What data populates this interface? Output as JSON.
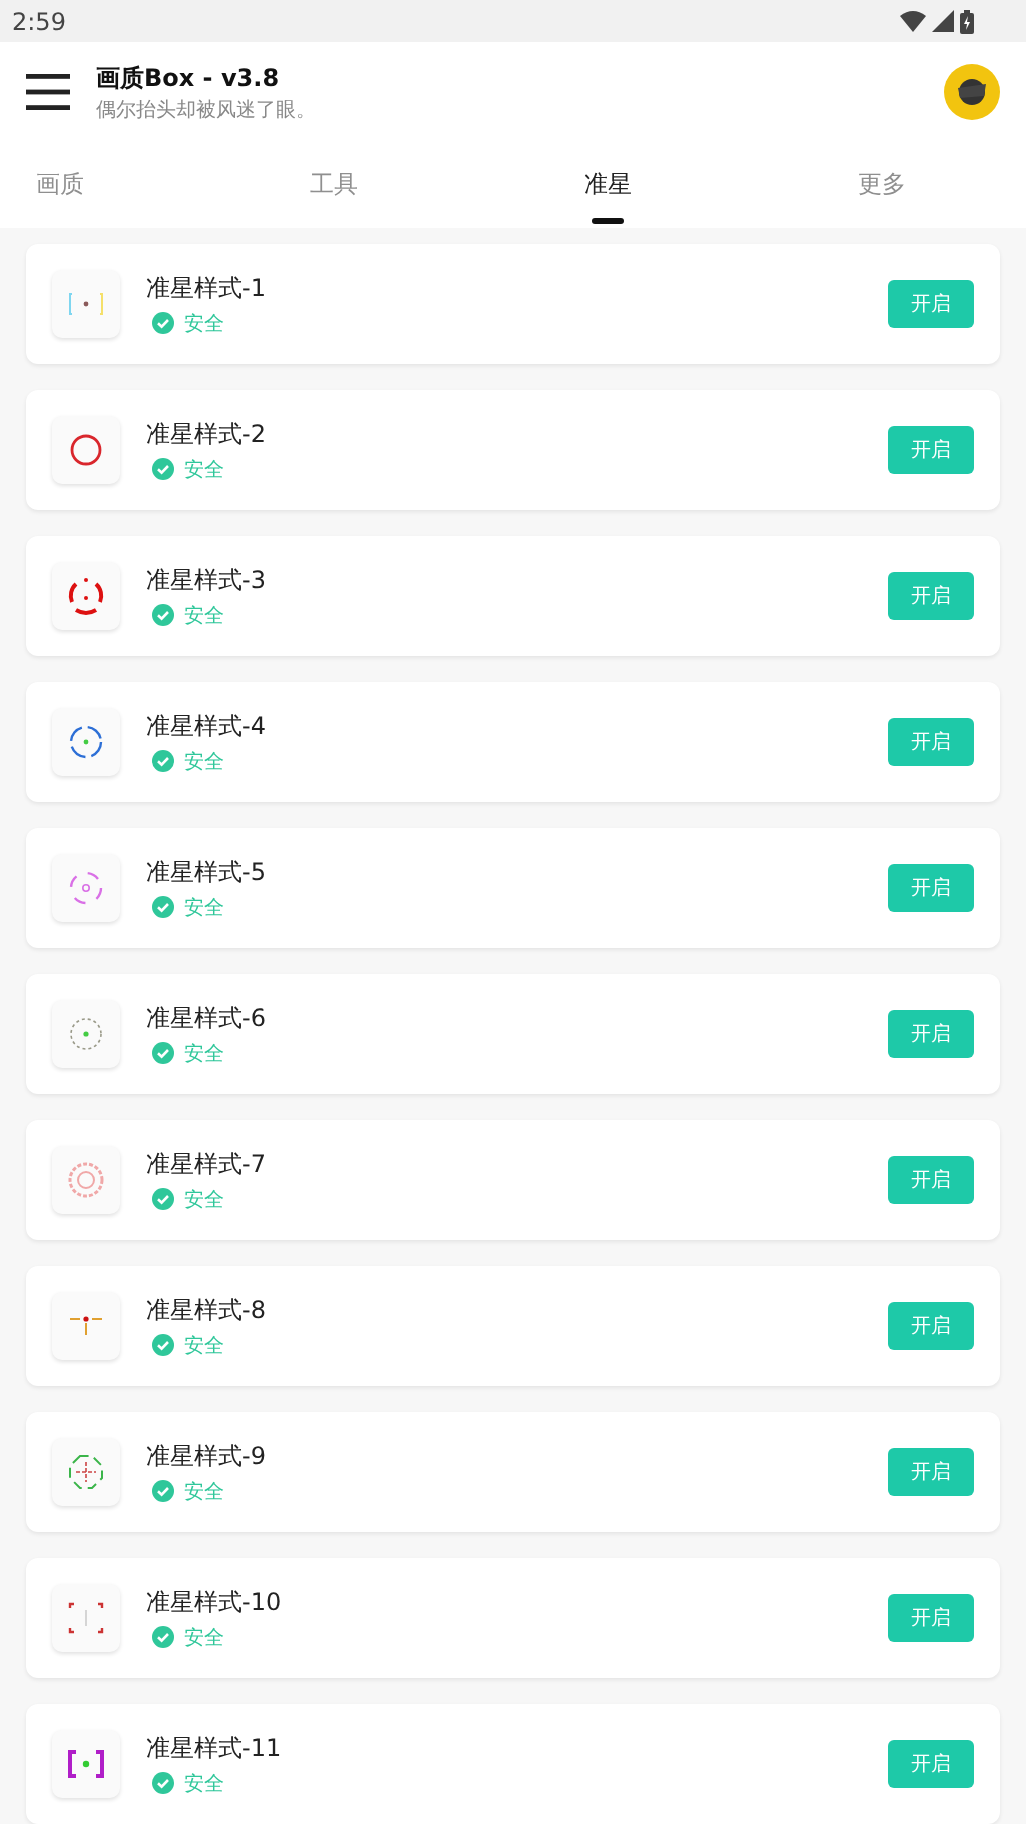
{
  "status_bar": {
    "time": "2:59"
  },
  "header": {
    "title": "画质Box - v3.8",
    "subtitle": "偶尔抬头却被风迷了眼。"
  },
  "tabs": [
    {
      "label": "画质",
      "selected": false
    },
    {
      "label": "工具",
      "selected": false
    },
    {
      "label": "准星",
      "selected": true
    },
    {
      "label": "更多",
      "selected": false
    }
  ],
  "items": [
    {
      "name": "准星样式-1",
      "status": "安全",
      "button": "开启"
    },
    {
      "name": "准星样式-2",
      "status": "安全",
      "button": "开启"
    },
    {
      "name": "准星样式-3",
      "status": "安全",
      "button": "开启"
    },
    {
      "name": "准星样式-4",
      "status": "安全",
      "button": "开启"
    },
    {
      "name": "准星样式-5",
      "status": "安全",
      "button": "开启"
    },
    {
      "name": "准星样式-6",
      "status": "安全",
      "button": "开启"
    },
    {
      "name": "准星样式-7",
      "status": "安全",
      "button": "开启"
    },
    {
      "name": "准星样式-8",
      "status": "安全",
      "button": "开启"
    },
    {
      "name": "准星样式-9",
      "status": "安全",
      "button": "开启"
    },
    {
      "name": "准星样式-10",
      "status": "安全",
      "button": "开启"
    },
    {
      "name": "准星样式-11",
      "status": "安全",
      "button": "开启"
    }
  ]
}
